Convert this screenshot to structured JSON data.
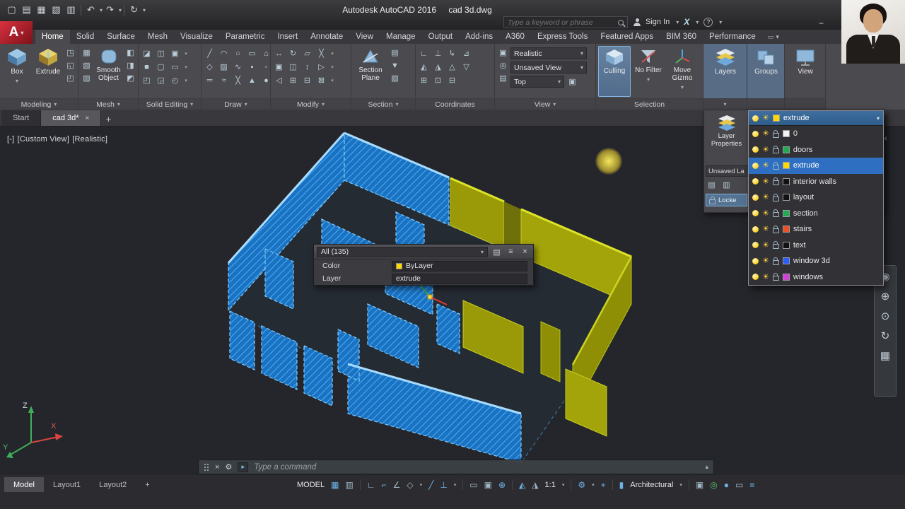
{
  "colors": {
    "qp_swatch": "#ffd800"
  },
  "titlebar": {
    "app_title": "Autodesk AutoCAD 2016",
    "doc_title": "cad 3d.dwg",
    "search_placeholder": "Type a keyword or phrase",
    "sign_in": "Sign In"
  },
  "tabs": {
    "items": [
      "Home",
      "Solid",
      "Surface",
      "Mesh",
      "Visualize",
      "Parametric",
      "Insert",
      "Annotate",
      "View",
      "Manage",
      "Output",
      "Add-ins",
      "A360",
      "Express Tools",
      "Featured Apps",
      "BIM 360",
      "Performance"
    ]
  },
  "ribbon": {
    "modeling": {
      "title": "Modeling",
      "box": "Box",
      "extrude": "Extrude"
    },
    "mesh": {
      "title": "Mesh",
      "smooth": "Smooth Object"
    },
    "solid": {
      "title": "Solid Editing"
    },
    "draw": {
      "title": "Draw"
    },
    "modify": {
      "title": "Modify"
    },
    "section": {
      "title": "Section",
      "plane": "Section Plane"
    },
    "coords": {
      "title": "Coordinates"
    },
    "view": {
      "title": "View",
      "style": "Realistic",
      "named": "Unsaved View",
      "vp": "Top"
    },
    "sel": {
      "title": "Selection",
      "culling": "Culling",
      "nofilter": "No Filter",
      "gizmo": "Move Gizmo"
    },
    "layers": {
      "title": "Layers",
      "props": "Layer Properties",
      "state": "Unsaved La",
      "lock": "Locke"
    },
    "groups": {
      "title": "Groups"
    },
    "view2": {
      "title": "View"
    }
  },
  "file_tabs": {
    "start": "Start",
    "active": "cad 3d*"
  },
  "viewport": {
    "controls": [
      "[-]",
      "[Custom View]",
      "[Realistic]"
    ]
  },
  "quick_properties": {
    "selection": "All (135)",
    "color_label": "Color",
    "color_value": "ByLayer",
    "layer_label": "Layer",
    "layer_value": "extrude"
  },
  "layer_dropdown": {
    "current": "extrude",
    "items": [
      {
        "name": "0",
        "color": "#f2f2f2"
      },
      {
        "name": "doors",
        "color": "#1fae4f"
      },
      {
        "name": "extrude",
        "color": "#ffd800"
      },
      {
        "name": "interior walls",
        "color": "#111111"
      },
      {
        "name": "layout",
        "color": "#111111"
      },
      {
        "name": "section",
        "color": "#1fae4f"
      },
      {
        "name": "stairs",
        "color": "#f04e23"
      },
      {
        "name": "text",
        "color": "#111111"
      },
      {
        "name": "window 3d",
        "color": "#2b5cff"
      },
      {
        "name": "windows",
        "color": "#d63fd6"
      }
    ]
  },
  "command_line": {
    "prompt": "Type a command"
  },
  "layout_tabs": {
    "items": [
      "Model",
      "Layout1",
      "Layout2"
    ]
  },
  "status_bar": {
    "model": "MODEL",
    "scale": "1:1",
    "units": "Architectural"
  },
  "glyphs": {
    "dropdown": "▾",
    "dropup": "▴",
    "close": "×",
    "plus": "+",
    "minimize": "−",
    "help": "?",
    "exchange": "X",
    "hamburger": "≡",
    "logo": "A",
    "qat": [
      "▢",
      "▤",
      "▦",
      "▧",
      "▥",
      "↶",
      "↷",
      "↻"
    ],
    "modeling_col": [
      "◳",
      "◱",
      "◰"
    ],
    "mesh_col1": [
      "▦",
      "▧",
      "▨"
    ],
    "mesh_col2": [
      "◧",
      "◨",
      "◩"
    ],
    "solid_r1": [
      "◪",
      "◫",
      "▣"
    ],
    "solid_r2": [
      "■",
      "▢",
      "▭"
    ],
    "solid_r3": [
      "◰",
      "◲",
      "◴"
    ],
    "draw_r1": [
      "╱",
      "◠",
      "○",
      "▭",
      "⌂"
    ],
    "draw_r2": [
      "◇",
      "▨",
      "∿",
      "▪",
      "◦"
    ],
    "draw_r3": [
      "═",
      "≈",
      "╳",
      "▲",
      "●"
    ],
    "modify_r1": [
      "↔",
      "↻",
      "▱",
      "╳"
    ],
    "modify_r2": [
      "▣",
      "◫",
      "↕",
      "▷"
    ],
    "modify_r3": [
      "◁",
      "⊞",
      "⊟",
      "⊠"
    ],
    "section_col": [
      "▤",
      "▼",
      "▧"
    ],
    "coords_r1": [
      "∟",
      "⊥",
      "↳",
      "⊿"
    ],
    "coords_r2": [
      "◭",
      "◮",
      "△",
      "▽"
    ],
    "coords_r3": [
      "⊞",
      "⊡",
      "⊟"
    ],
    "view_col": [
      "▣",
      "◎",
      "▤"
    ],
    "flyout_icons": [
      "▤",
      "▥"
    ],
    "navbar": [
      "◉",
      "⊕",
      "⊙",
      "↻",
      "▦"
    ],
    "cmd": {
      "wrench": "⚙",
      "prompt": "▸"
    },
    "status": {
      "grid": "▦",
      "snap": "▥",
      "infer": "∟",
      "ortho": "⌐",
      "polar": "∠",
      "iso": "◇",
      "otrack": "╱",
      "osnap": "⊥",
      "lwt": "▭",
      "cycling": "▣",
      "gizmo": "⊕",
      "annovis": "◭",
      "autoscale": "◮",
      "gear": "⚙",
      "monitor": "▤",
      "units": "▮",
      "qp": "▣",
      "isolate": "◎",
      "perf": "●",
      "clean": "▭"
    }
  }
}
